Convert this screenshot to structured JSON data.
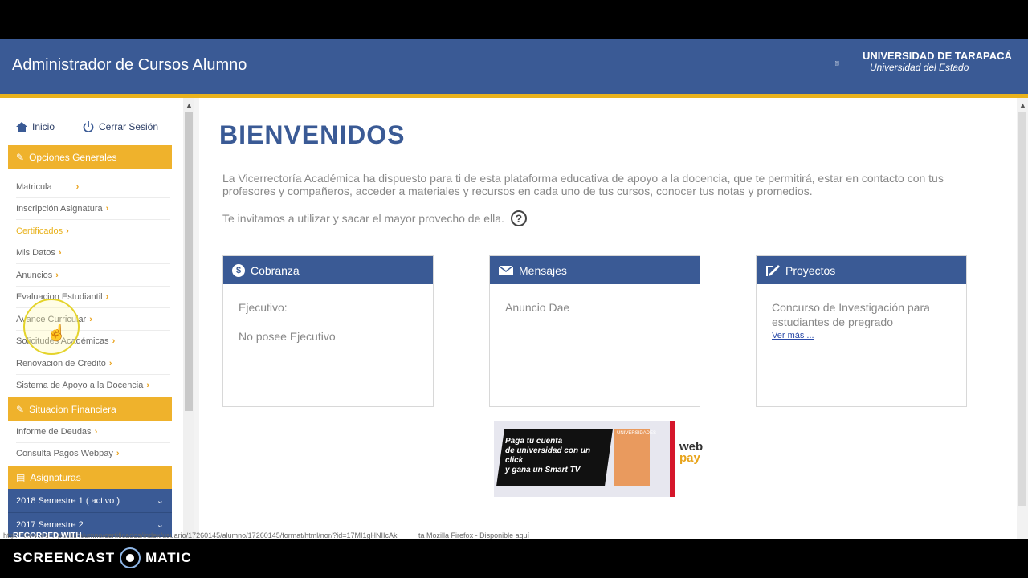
{
  "header": {
    "title": "Administrador de Cursos Alumno",
    "logo_title": "UNIVERSIDAD DE TARAPACÁ",
    "logo_subtitle": "Universidad del Estado"
  },
  "topnav": {
    "home_label": "Inicio",
    "logout_label": "Cerrar Sesión"
  },
  "sidebar": {
    "sections": [
      {
        "title": "Opciones Generales",
        "items": [
          {
            "label": "Matricula"
          },
          {
            "label": "Inscripción Asignatura"
          },
          {
            "label": "Certificados"
          },
          {
            "label": "Mis Datos"
          },
          {
            "label": "Anuncios"
          },
          {
            "label": "Evaluacion Estudiantil"
          },
          {
            "label": "Avance Curricular"
          },
          {
            "label": "Solicitudes Académicas"
          },
          {
            "label": "Renovacion de Credito"
          },
          {
            "label": "Sistema de Apoyo a la Docencia"
          }
        ]
      },
      {
        "title": "Situacion Financiera",
        "items": [
          {
            "label": "Informe de Deudas"
          },
          {
            "label": "Consulta Pagos Webpay"
          }
        ]
      },
      {
        "title": "Asignaturas",
        "items": [
          {
            "label": "2018 Semestre 1 ( activo )"
          },
          {
            "label": "2017 Semestre 2"
          }
        ]
      }
    ]
  },
  "main": {
    "title": "BIENVENIDOS",
    "intro": "La Vicerrectoría Académica ha dispuesto para ti de esta plataforma educativa de apoyo a la docencia, que te permitirá, estar en contacto con tus profesores y compañeros, acceder a materiales y recursos en cada uno de tus cursos, conocer tus notas y promedios.",
    "invite": "Te invitamos a utilizar y sacar el mayor provecho de ella.",
    "help_icon": "?",
    "cards": [
      {
        "title": "Cobranza",
        "icon": "dollar-icon",
        "line1": "Ejecutivo:",
        "line2": "No posee Ejecutivo"
      },
      {
        "title": "Mensajes",
        "icon": "envelope-icon",
        "line1": "Anuncio Dae"
      },
      {
        "title": "Proyectos",
        "icon": "edit-icon",
        "line1": "Concurso de Investigación para estudiantes de pregrado",
        "link": "Ver más ..."
      }
    ],
    "banner": {
      "text_line1": "Paga tu cuenta",
      "text_line2": "de universidad con un click",
      "text_line3": "y gana un Smart TV",
      "book_label": "UNIVERSIDADES",
      "webpay_label_a": "web",
      "webpay_label_b": "pay"
    }
  },
  "statusbar": {
    "url": "http://www.uta.cl/public/alumno/certificados/index/usuario/17260145/alumno/17260145/format/html/nor/?id=17MI1gHNIIcAk",
    "footer_note": "ta Mozilla Firefox - Disponible aquí"
  },
  "watermark": {
    "recorded": "RECORDED WITH",
    "brand_a": "SCREENCAST",
    "brand_b": "MATIC"
  },
  "colors": {
    "primary": "#3a5a95",
    "accent": "#efb22c"
  }
}
